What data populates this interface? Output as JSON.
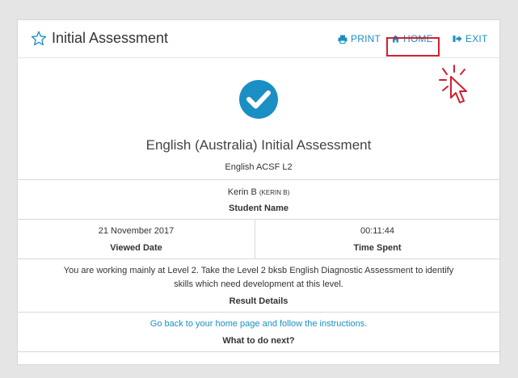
{
  "header": {
    "title": "Initial Assessment",
    "print_label": "PRINT",
    "home_label": "HOME",
    "exit_label": "EXIT"
  },
  "assessment": {
    "title": "English (Australia) Initial Assessment",
    "subtitle": "English ACSF L2"
  },
  "student": {
    "name": "Kerin B",
    "username": "(KERIN B)",
    "label": "Student Name"
  },
  "viewed": {
    "value": "21 November 2017",
    "label": "Viewed Date"
  },
  "time_spent": {
    "value": "00:11:44",
    "label": "Time Spent"
  },
  "result": {
    "line1": "You are working mainly at Level 2. Take the Level 2 bksb English Diagnostic Assessment to identify",
    "line2": "skills which need development at this level.",
    "label": "Result Details"
  },
  "next": {
    "value": "Go back to your home page and follow the instructions.",
    "label": "What to do next?"
  },
  "colors": {
    "accent": "#1a8fc4",
    "highlight": "#d21f2f"
  }
}
